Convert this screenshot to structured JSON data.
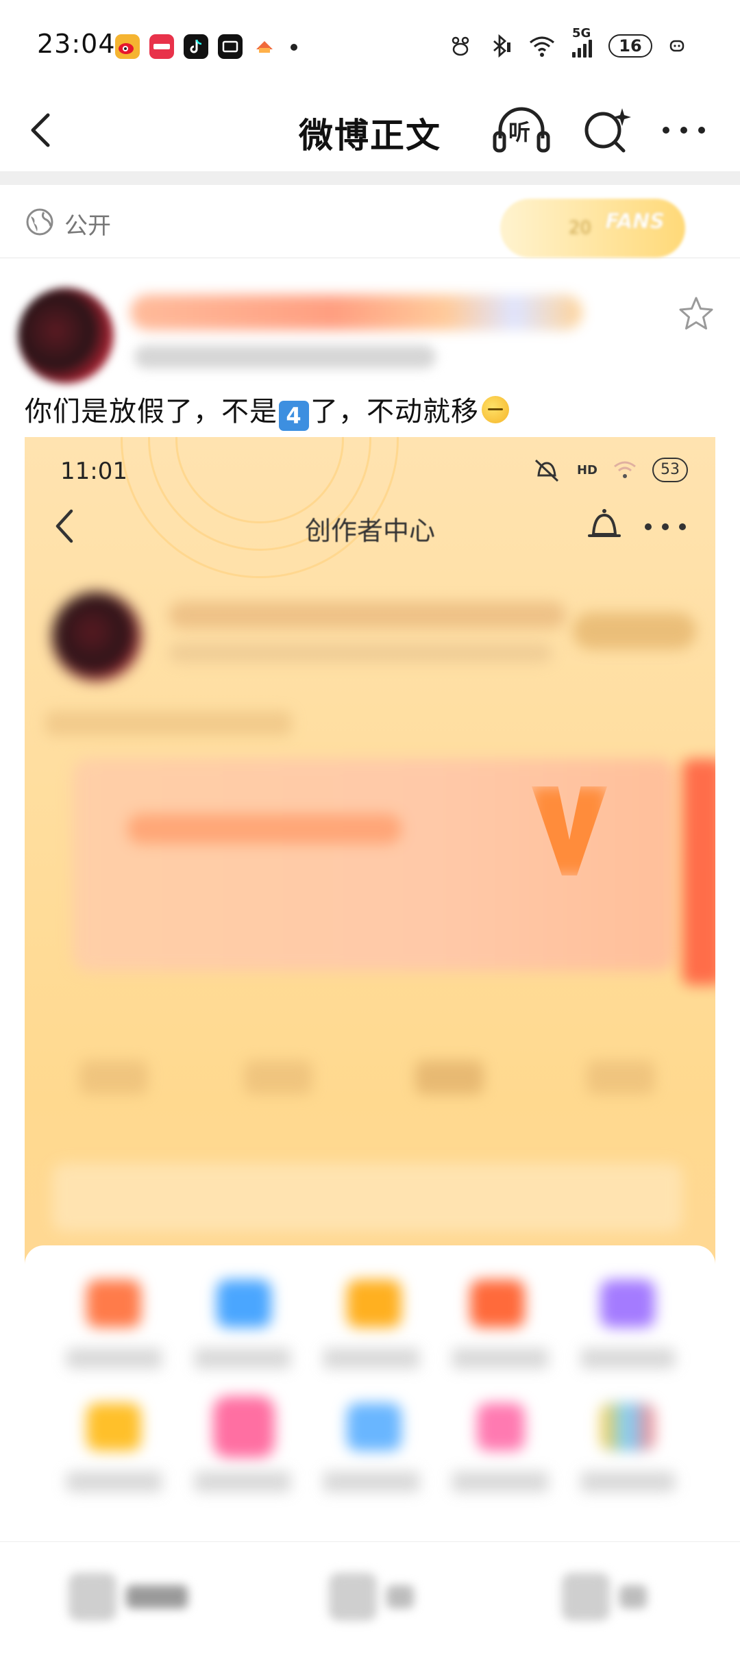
{
  "status_bar": {
    "time": "23:04",
    "network": "5G",
    "battery": "16",
    "app_icons": [
      {
        "name": "weibo-app-icon",
        "color": "#f5b431"
      },
      {
        "name": "xiaohongshu-app-icon",
        "color": "#e8324a"
      },
      {
        "name": "douyin-app-icon",
        "color": "#111111"
      },
      {
        "name": "dewu-app-icon",
        "color": "#111111"
      },
      {
        "name": "games-app-icon",
        "color": "#f06a3b"
      }
    ]
  },
  "nav": {
    "title": "微博正文",
    "listen_label": "听"
  },
  "visibility": {
    "label": "公开",
    "fans_badge": "FANS",
    "fans_level": "20"
  },
  "post": {
    "text_before": "你们是放假了，不是",
    "keycap": "4",
    "text_after": "了，不动就移"
  },
  "image": {
    "time": "11:01",
    "hd_label": "HD",
    "battery": "53",
    "title": "创作者中心"
  },
  "colors": {
    "accent_orange": "#ff8c3b",
    "image_bg": "#ffd98f",
    "keycap_blue": "#3d8fe0"
  }
}
